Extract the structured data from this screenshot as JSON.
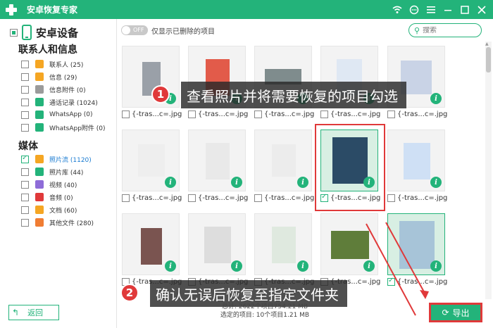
{
  "window": {
    "title": "安卓恢复专家",
    "controls": [
      "wifi-icon",
      "chat-icon",
      "menu-icon",
      "minimize-icon",
      "maximize-icon",
      "close-icon"
    ]
  },
  "sidebar": {
    "device_label": "安卓设备",
    "section_contacts": "联系人和信息",
    "section_media": "媒体",
    "items": [
      {
        "label": "联系人 (25)",
        "icon": "contact-icon",
        "color": "#f5a623",
        "checked": false
      },
      {
        "label": "信息 (29)",
        "icon": "message-icon",
        "color": "#f5a623",
        "checked": false
      },
      {
        "label": "信息附件 (0)",
        "icon": "attachment-icon",
        "color": "#9b9b9b",
        "checked": false
      },
      {
        "label": "通话记录 (1024)",
        "icon": "phone-icon",
        "color": "#23b37a",
        "checked": false
      },
      {
        "label": "WhatsApp (0)",
        "icon": "whatsapp-icon",
        "color": "#23b37a",
        "checked": false
      },
      {
        "label": "WhatsApp附件 (0)",
        "icon": "whatsapp-attachment-icon",
        "color": "#23b37a",
        "checked": false
      },
      {
        "label": "照片流 (1120)",
        "icon": "photo-stream-icon",
        "color": "#f5a623",
        "checked": true,
        "active": true
      },
      {
        "label": "照片库 (44)",
        "icon": "photo-library-icon",
        "color": "#23b37a",
        "checked": false
      },
      {
        "label": "视频 (40)",
        "icon": "video-icon",
        "color": "#8e6cd8",
        "checked": false
      },
      {
        "label": "音频 (0)",
        "icon": "audio-icon",
        "color": "#e0393a",
        "checked": false
      },
      {
        "label": "文档 (60)",
        "icon": "document-icon",
        "color": "#f5a623",
        "checked": false
      },
      {
        "label": "其他文件 (280)",
        "icon": "other-files-icon",
        "color": "#f07d33",
        "checked": false
      }
    ],
    "back_label": "返回"
  },
  "topbar": {
    "toggle_state": "OFF",
    "toggle_label": "仅显示已删除的项目",
    "search_placeholder": "搜索"
  },
  "files": [
    {
      "name": "{-tras...c=.jpg",
      "selected": false
    },
    {
      "name": "{-tras...c=.jpg",
      "selected": false
    },
    {
      "name": "{-tras...c=.jpg",
      "selected": false
    },
    {
      "name": "{-tras...c=.jpg",
      "selected": false
    },
    {
      "name": "{-tras...c=.jpg",
      "selected": false
    },
    {
      "name": "{-tras...c=.jpg",
      "selected": false
    },
    {
      "name": "{-tras...c=.jpg",
      "selected": false
    },
    {
      "name": "{-tras...c=.jpg",
      "selected": false
    },
    {
      "name": "{-tras...c=.jpg",
      "selected": true
    },
    {
      "name": "{-tras...c=.jpg",
      "selected": false
    },
    {
      "name": "{-tras...c=.jpg",
      "selected": false
    },
    {
      "name": "{-tras...c=.jpg",
      "selected": false
    },
    {
      "name": "{-tras...c=.jpg",
      "selected": false
    },
    {
      "name": "{-tras...c=.jpg",
      "selected": false
    },
    {
      "name": "{-tras...c=.jpg",
      "selected": true
    }
  ],
  "callouts": [
    {
      "number": "1",
      "text": "查看照片并将需要恢复的项目勾选"
    },
    {
      "number": "2",
      "text": "确认无误后恢复至指定文件夹"
    }
  ],
  "status": {
    "total": "总计: 2622个项目754.21 MB",
    "selected": "选定的项目: 10个项目1.21 MB"
  },
  "export_label": "导出",
  "colors": {
    "accent": "#23b37a",
    "highlight": "#e0393a"
  }
}
